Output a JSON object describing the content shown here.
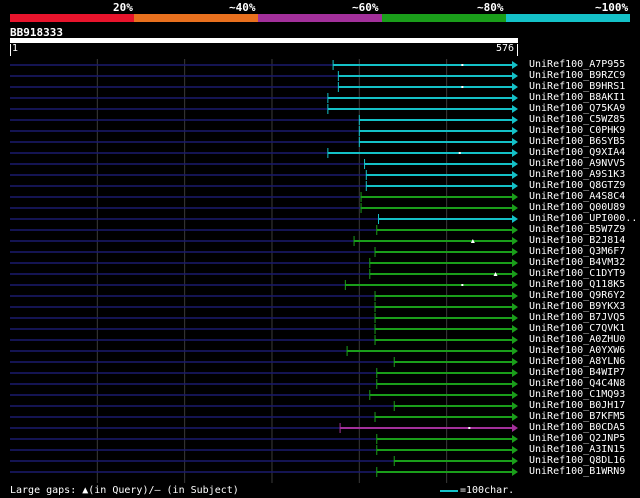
{
  "legend": {
    "labels": [
      "20%",
      "~40%",
      "~60%",
      "~80%",
      "~100%"
    ],
    "colors": [
      "#e8142c",
      "#e8701e",
      "#a3309b",
      "#1a9e1a",
      "#14c1c8"
    ]
  },
  "query": {
    "name": "BB918333",
    "start_label": "1",
    "end_label": "576",
    "length": 576
  },
  "hits": [
    {
      "name": "UniRef100_A7P955",
      "start": 370,
      "end": 576,
      "color": "cyan",
      "mark": 518
    },
    {
      "name": "UniRef100_B9RZC9",
      "start": 376,
      "end": 576,
      "color": "cyan"
    },
    {
      "name": "UniRef100_B9HRS1",
      "start": 376,
      "end": 576,
      "color": "cyan",
      "mark": 518
    },
    {
      "name": "UniRef100_B8AKI1",
      "start": 364,
      "end": 576,
      "color": "cyan"
    },
    {
      "name": "UniRef100_Q75KA9",
      "start": 364,
      "end": 576,
      "color": "cyan"
    },
    {
      "name": "UniRef100_C5WZ85",
      "start": 400,
      "end": 576,
      "color": "cyan"
    },
    {
      "name": "UniRef100_C0PHK9",
      "start": 400,
      "end": 576,
      "color": "cyan"
    },
    {
      "name": "UniRef100_B6SYB5",
      "start": 400,
      "end": 576,
      "color": "cyan"
    },
    {
      "name": "UniRef100_Q9XIA4",
      "start": 364,
      "end": 576,
      "color": "cyan",
      "mark": 515
    },
    {
      "name": "UniRef100_A9NVV5",
      "start": 406,
      "end": 576,
      "color": "cyan"
    },
    {
      "name": "UniRef100_A9S1K3",
      "start": 408,
      "end": 576,
      "color": "cyan"
    },
    {
      "name": "UniRef100_Q8GTZ9",
      "start": 408,
      "end": 576,
      "color": "cyan"
    },
    {
      "name": "UniRef100_A4S8C4",
      "start": 402,
      "end": 576,
      "color": "green"
    },
    {
      "name": "UniRef100_Q00U89",
      "start": 402,
      "end": 576,
      "color": "green"
    },
    {
      "name": "UniRef100_UPI000..",
      "start": 422,
      "end": 576,
      "color": "cyan"
    },
    {
      "name": "UniRef100_B5W7Z9",
      "start": 420,
      "end": 576,
      "color": "green"
    },
    {
      "name": "UniRef100_B2J814",
      "start": 394,
      "end": 576,
      "color": "green"
    },
    {
      "name": "UniRef100_Q3M6F7",
      "start": 418,
      "end": 576,
      "color": "green"
    },
    {
      "name": "UniRef100_B4VM32",
      "start": 412,
      "end": 576,
      "color": "green"
    },
    {
      "name": "UniRef100_C1DYT9",
      "start": 412,
      "end": 576,
      "color": "green"
    },
    {
      "name": "UniRef100_Q118K5",
      "start": 384,
      "end": 576,
      "color": "green",
      "mark": 518
    },
    {
      "name": "UniRef100_Q9R6Y2",
      "start": 418,
      "end": 576,
      "color": "green"
    },
    {
      "name": "UniRef100_B9YKX3",
      "start": 418,
      "end": 576,
      "color": "green"
    },
    {
      "name": "UniRef100_B7JVQ5",
      "start": 418,
      "end": 576,
      "color": "green"
    },
    {
      "name": "UniRef100_C7QVK1",
      "start": 418,
      "end": 576,
      "color": "green"
    },
    {
      "name": "UniRef100_A0ZHU0",
      "start": 418,
      "end": 576,
      "color": "green"
    },
    {
      "name": "UniRef100_A0YXW6",
      "start": 386,
      "end": 576,
      "color": "green"
    },
    {
      "name": "UniRef100_A8YLN6",
      "start": 440,
      "end": 576,
      "color": "green"
    },
    {
      "name": "UniRef100_B4WIP7",
      "start": 420,
      "end": 576,
      "color": "green"
    },
    {
      "name": "UniRef100_Q4C4N8",
      "start": 420,
      "end": 576,
      "color": "green"
    },
    {
      "name": "UniRef100_C1MQ93",
      "start": 412,
      "end": 576,
      "color": "green"
    },
    {
      "name": "UniRef100_B0JH17",
      "start": 440,
      "end": 576,
      "color": "green"
    },
    {
      "name": "UniRef100_B7KFM5",
      "start": 418,
      "end": 576,
      "color": "green"
    },
    {
      "name": "UniRef100_B0CDA5",
      "start": 378,
      "end": 576,
      "color": "magenta",
      "mark": 526
    },
    {
      "name": "UniRef100_Q2JNP5",
      "start": 420,
      "end": 576,
      "color": "green"
    },
    {
      "name": "UniRef100_A3IN15",
      "start": 420,
      "end": 576,
      "color": "green"
    },
    {
      "name": "UniRef100_Q8DL16",
      "start": 440,
      "end": 576,
      "color": "green"
    },
    {
      "name": "UniRef100_B1WRN9",
      "start": 420,
      "end": 576,
      "color": "green"
    }
  ],
  "colors": {
    "cyan": "#14c1c8",
    "green": "#1a9e1a",
    "magenta": "#a3309b",
    "navy": "#1a1a6e",
    "grid": "#3a3a3a"
  },
  "gap_markers": [
    {
      "row": 16,
      "pos": 530
    },
    {
      "row": 19,
      "pos": 556
    }
  ],
  "footer": {
    "gaps_text": "Large gaps: ▲(in Query)/— (in Subject)",
    "scale_text": "=100char."
  }
}
